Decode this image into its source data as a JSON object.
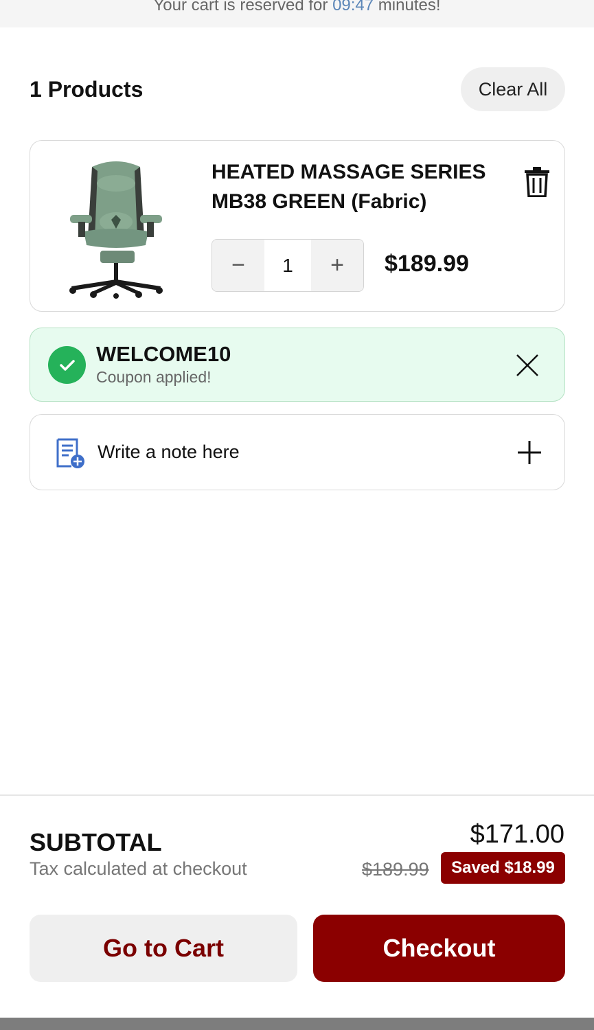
{
  "timer": {
    "prefix": "Your cart is reserved for ",
    "time": "09:47",
    "suffix": " minutes!"
  },
  "header": {
    "products_count": "1 Products",
    "clear_all_label": "Clear All"
  },
  "product": {
    "title": "HEATED MASSAGE SERIES MB38 GREEN (Fabric)",
    "quantity": "1",
    "price": "$189.99",
    "decrement_symbol": "−",
    "increment_symbol": "+",
    "image_icon": "chair-icon"
  },
  "coupon": {
    "code": "WELCOME10",
    "status": "Coupon applied!"
  },
  "note": {
    "label": "Write a note here"
  },
  "summary": {
    "subtotal_label": "SUBTOTAL",
    "tax_note": "Tax calculated at checkout",
    "subtotal_value": "$171.00",
    "original_price": "$189.99",
    "saved": "Saved $18.99"
  },
  "actions": {
    "go_to_cart": "Go to Cart",
    "checkout": "Checkout"
  },
  "colors": {
    "brand": "#8b0000",
    "success": "#25b25a",
    "coupon_bg": "#e7fbef",
    "timer_accent": "#5b86b8"
  }
}
